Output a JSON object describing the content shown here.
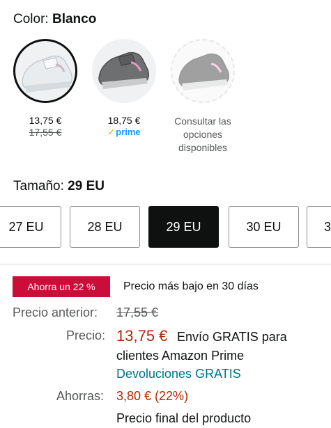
{
  "color": {
    "label": "Color:",
    "value": "Blanco"
  },
  "swatches": [
    {
      "price": "13,75 €",
      "old_price": "17,55 €"
    },
    {
      "price": "18,75 €",
      "badge": "prime"
    },
    {
      "text": "Consultar las opciones disponibles",
      "line1": "Consultar las",
      "line2": "opciones",
      "line3": "disponibles"
    }
  ],
  "size": {
    "label": "Tamaño:",
    "value": "29 EU",
    "options": [
      "27 EU",
      "28 EU",
      "29 EU",
      "30 EU",
      "3"
    ]
  },
  "deal": {
    "badge": "Ahorra un 22 %",
    "note": "Precio más bajo en 30 días"
  },
  "pricing": {
    "previous_label": "Precio anterior:",
    "previous_value": "17,55 €",
    "price_label": "Precio:",
    "price_value": "13,75 €",
    "shipping_line1": "Envío GRATIS para",
    "shipping_line2": "clientes Amazon Prime",
    "returns": "Devoluciones GRATIS",
    "savings_label": "Ahorras:",
    "savings_value": "3,80 € (22%)",
    "final_text": "Precio final del producto"
  },
  "colors": {
    "deal_red": "#cc0c39",
    "price_red": "#b12704",
    "link_teal": "#007185",
    "prime_blue": "#1a98ff"
  }
}
